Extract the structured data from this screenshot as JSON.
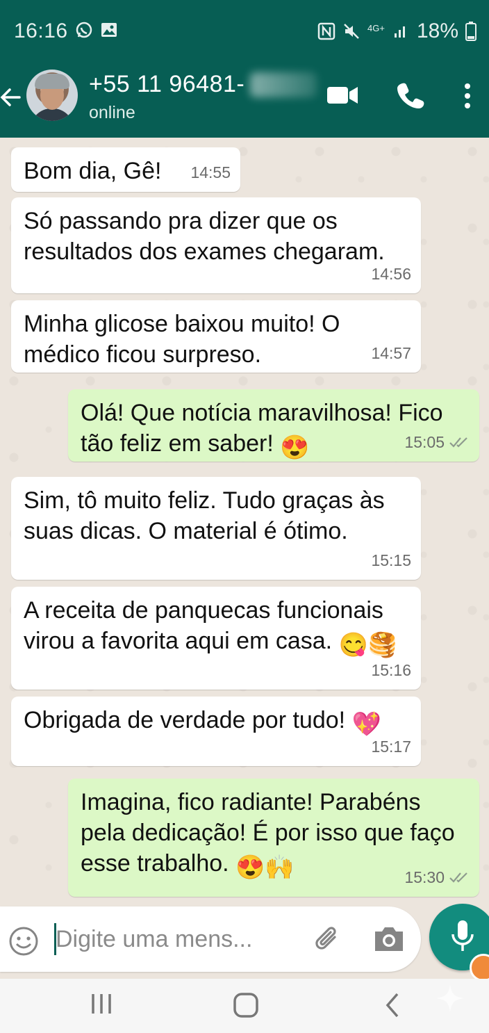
{
  "status_bar": {
    "time": "16:16",
    "network": "4G+",
    "battery": "18%"
  },
  "header": {
    "contact_name": "+55 11 96481-",
    "contact_status": "online"
  },
  "messages": [
    {
      "direction": "in",
      "text": "Bom dia, Gê!",
      "time": "14:55"
    },
    {
      "direction": "in",
      "text": "Só passando pra dizer que os resultados dos exames chegaram.",
      "time": "14:56"
    },
    {
      "direction": "in",
      "text": "Minha glicose baixou muito! O médico ficou surpreso.",
      "time": "14:57"
    },
    {
      "direction": "out",
      "text": "Olá! Que notícia maravilhosa! Fico tão feliz em saber!",
      "emoji": "😍",
      "time": "15:05"
    },
    {
      "direction": "in",
      "text": "Sim, tô muito feliz. Tudo graças às suas dicas. O material é ótimo.",
      "time": "15:15"
    },
    {
      "direction": "in",
      "text": "A receita de panquecas funcionais virou a favorita aqui em casa.",
      "emoji": "😋🥞",
      "time": "15:16"
    },
    {
      "direction": "in",
      "text": "Obrigada de verdade por tudo!",
      "emoji": "💖",
      "time": "15:17"
    },
    {
      "direction": "out",
      "text": "Imagina, fico radiante! Parabéns pela dedicação! É por isso que faço esse trabalho.",
      "emoji": "😍🙌",
      "time": "15:30"
    }
  ],
  "composer": {
    "placeholder": "Digite uma mens..."
  },
  "colors": {
    "header": "#075e54",
    "outgoing_bubble": "#dcf8c6",
    "incoming_bubble": "#ffffff",
    "mic_button": "#128c7e"
  }
}
